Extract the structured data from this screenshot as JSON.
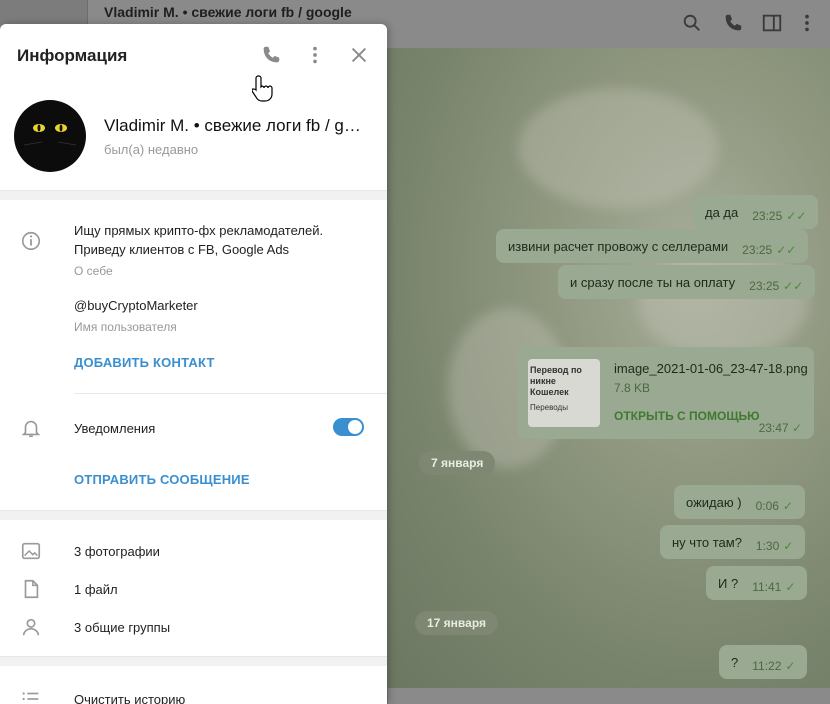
{
  "window": {
    "chat_title": "Vladimir M. • свежие логи fb / google"
  },
  "panel": {
    "title": "Информация",
    "profile": {
      "name": "Vladimir M. • свежие логи fb / google",
      "status": "был(а) недавно"
    },
    "about": {
      "text_line1": "Ищу прямых крипто-фх рекламодателей.",
      "text_line2": "Приведу клиентов с FB, Google Ads",
      "label": "О себе"
    },
    "username": {
      "value": "@buyCryptoMarketer",
      "label": "Имя пользователя"
    },
    "add_contact": "ДОБАВИТЬ КОНТАКТ",
    "notifications": {
      "label": "Уведомления",
      "enabled": true
    },
    "send_message": "ОТПРАВИТЬ СООБЩЕНИЕ",
    "media": {
      "photos": "3 фотографии",
      "files": "1 файл",
      "groups": "3 общие группы"
    },
    "clear_history": "Очистить историю"
  },
  "messages": [
    {
      "text": "да да",
      "time": "23:25"
    },
    {
      "text": "извини расчет провожу с селлерами",
      "time": "23:25"
    },
    {
      "text": "и сразу после ты на оплату",
      "time": "23:25"
    },
    {
      "text": "ожидаю )",
      "time": "0:06"
    },
    {
      "text": "ну что там?",
      "time": "1:30"
    },
    {
      "text": "И ?",
      "time": "11:41"
    },
    {
      "text": "?",
      "time": "11:22"
    }
  ],
  "file_message": {
    "name": "image_2021-01-06_23-47-18.png",
    "size": "7.8 KB",
    "open_label": "ОТКРЫТЬ С ПОМОЩЬЮ",
    "time": "23:47",
    "thumb_line1": "Перевод по никне",
    "thumb_line2": "Кошелек",
    "thumb_line3": "Переводы"
  },
  "dates": {
    "d1": "7 января",
    "d2": "17 января"
  },
  "colors": {
    "accent": "#3a8fd0",
    "bubble": "#9aa992",
    "check": "#4b8a3a"
  }
}
